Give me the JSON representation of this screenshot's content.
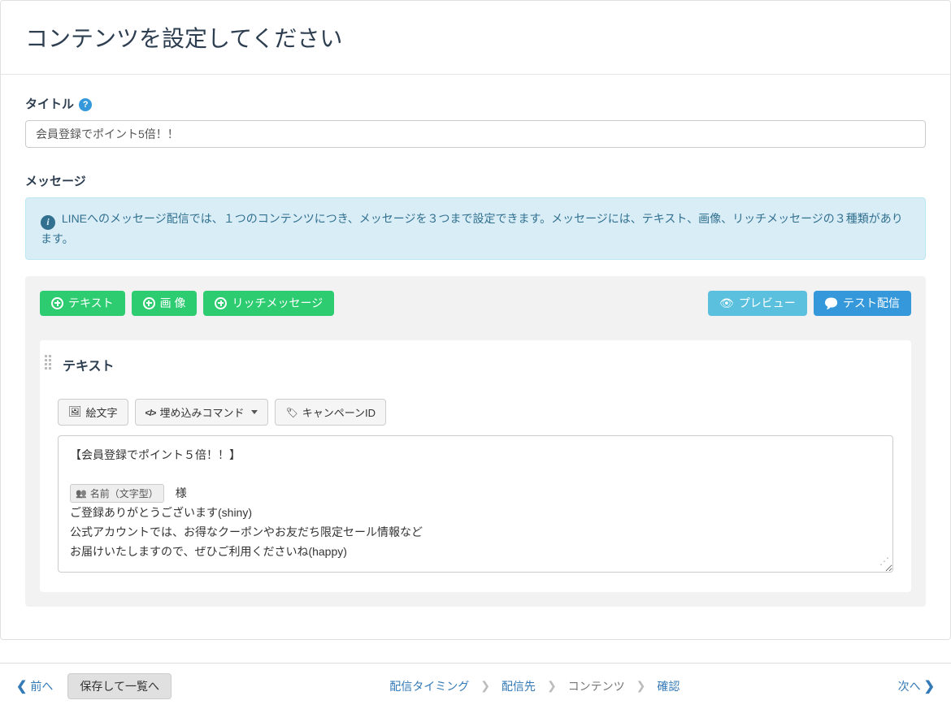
{
  "page": {
    "title": "コンテンツを設定してください"
  },
  "title_field": {
    "label": "タイトル",
    "value": "会員登録でポイント5倍！！"
  },
  "message_section": {
    "label": "メッセージ",
    "info": "LINEへのメッセージ配信では、１つのコンテンツにつき、メッセージを３つまで設定できます。メッセージには、テキスト、画像、リッチメッセージの３種類があります。"
  },
  "add_buttons": {
    "text": "テキスト",
    "image": "画 像",
    "rich": "リッチメッセージ"
  },
  "action_buttons": {
    "preview": "プレビュー",
    "test_send": "テスト配信"
  },
  "text_card": {
    "title": "テキスト",
    "toolbar": {
      "emoji": "絵文字",
      "embed": "埋め込みコマンド",
      "campaign_id": "キャンペーンID"
    },
    "content": {
      "line1": "【会員登録でポイント５倍！！】",
      "var_label": "名前（文字型）",
      "after_var": "　様",
      "line3": "ご登録ありがとうございます(shiny)",
      "line4": "公式アカウントでは、お得なクーポンやお友だち限定セール情報など",
      "line5": "お届けいたしますので、ぜひご利用くださいね(happy)"
    }
  },
  "footer": {
    "prev": "前へ",
    "save_list": "保存して一覧へ",
    "next": "次へ",
    "steps": {
      "timing": "配信タイミング",
      "target": "配信先",
      "content": "コンテンツ",
      "confirm": "確認"
    }
  }
}
